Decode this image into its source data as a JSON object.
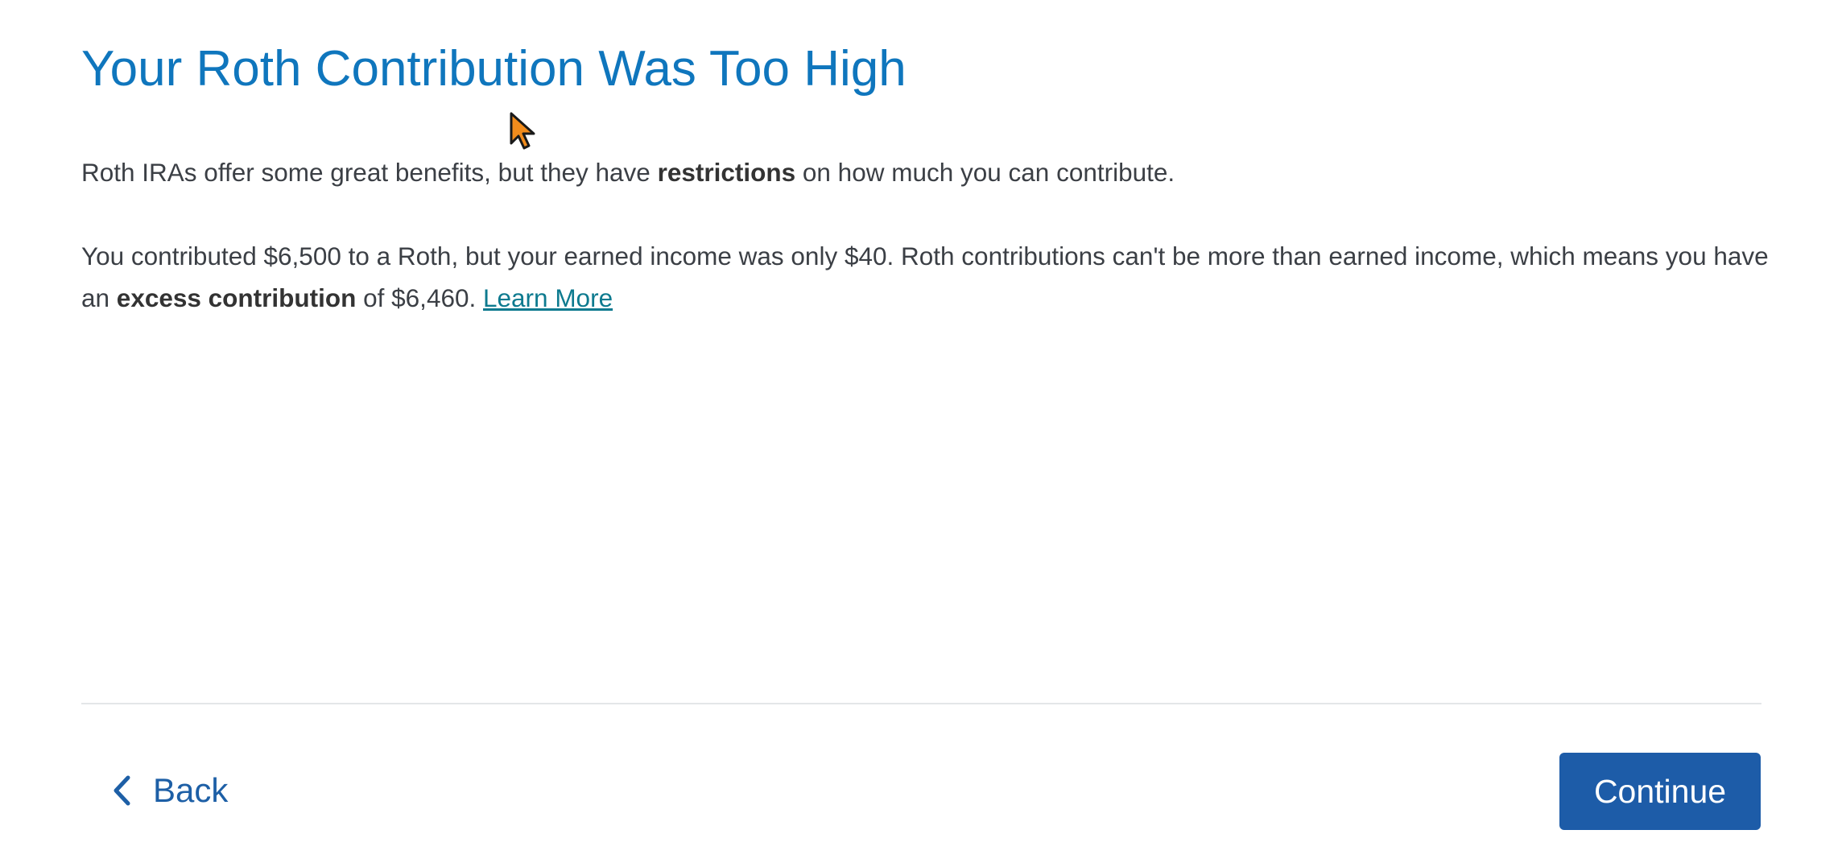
{
  "page": {
    "title": "Your Roth Contribution Was Too High"
  },
  "content": {
    "para1": {
      "before": "Roth IRAs offer some great benefits, but they have ",
      "bold": "restrictions",
      "after": " on how much you can contribute."
    },
    "para2": {
      "before": "You contributed $6,500 to a Roth, but your earned income was only $40. Roth contributions can't be more than earned income, which means you have an ",
      "bold": "excess contribution",
      "after": " of $6,460. ",
      "link": "Learn More"
    }
  },
  "footer": {
    "back_label": "Back",
    "continue_label": "Continue"
  },
  "icons": {
    "back": "chevron-left-icon",
    "cursor": "mouse-pointer-icon"
  },
  "colors": {
    "title": "#0f76bd",
    "link": "#0d7a8f",
    "primary_button": "#1d5ca8",
    "back_text": "#1d5fa6"
  }
}
